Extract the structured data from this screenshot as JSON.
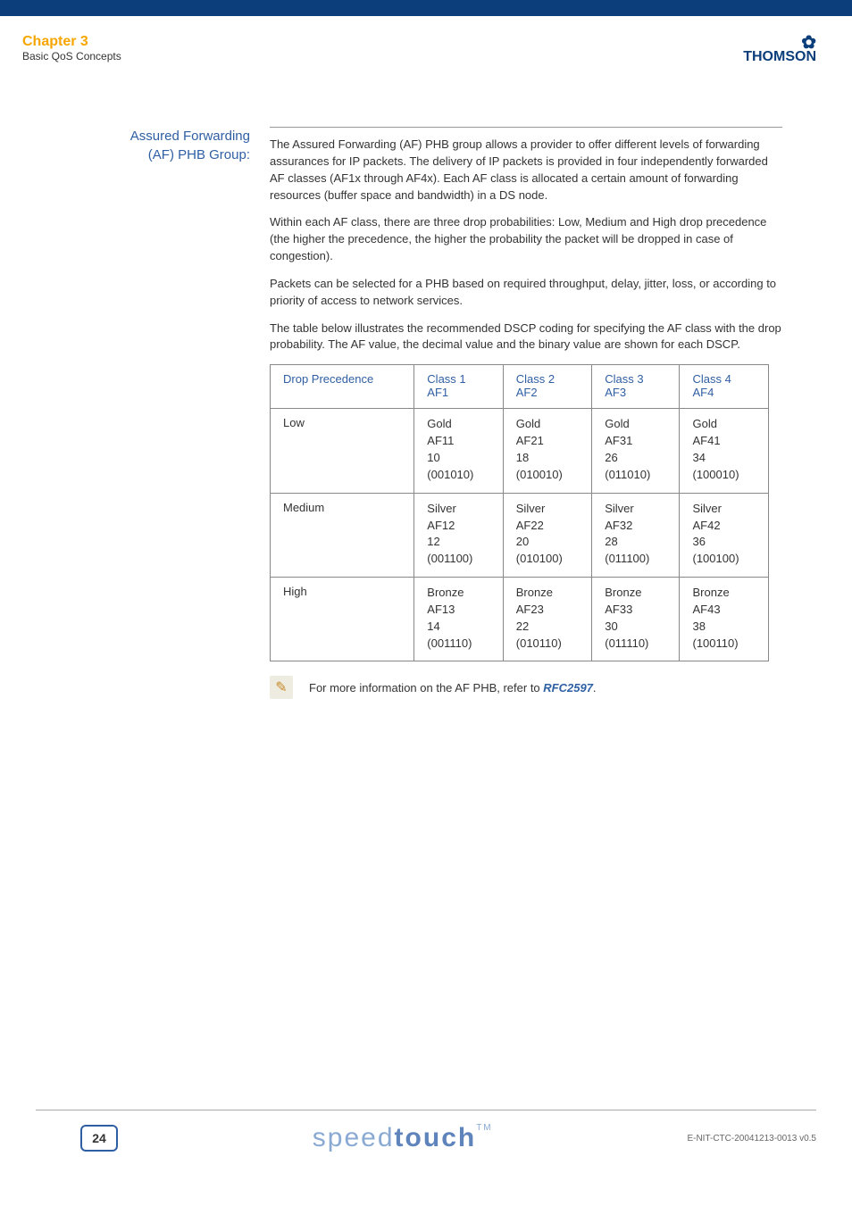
{
  "header": {
    "chapter": "Chapter 3",
    "subtitle": "Basic QoS Concepts",
    "brand": "THOMSON"
  },
  "section": {
    "label_line1": "Assured Forwarding",
    "label_line2": "(AF) PHB Group:",
    "paragraphs": {
      "p1": "The Assured Forwarding (AF) PHB group allows a provider to offer different levels of forwarding assurances for IP packets. The delivery of IP packets is provided in four independently forwarded AF classes (AF1x through AF4x). Each AF class is allocated a certain amount of forwarding resources (buffer space and bandwidth) in a DS node.",
      "p2": "Within each AF class, there are three drop probabilities: Low, Medium and High drop precedence (the higher the precedence, the higher the probability the packet will be dropped in case of congestion).",
      "p3": "Packets can be selected for a PHB based on required throughput, delay, jitter, loss, or according to priority of access to network services.",
      "p4": "The table below illustrates the recommended DSCP coding for specifying the AF class with the drop probability. The AF value, the decimal value and the binary value are shown for each DSCP."
    }
  },
  "table": {
    "headers": {
      "col0": "Drop Precedence",
      "col1_l1": "Class 1",
      "col1_l2": "AF1",
      "col2_l1": "Class 2",
      "col2_l2": "AF2",
      "col3_l1": "Class 3",
      "col3_l2": "AF3",
      "col4_l1": "Class 4",
      "col4_l2": "AF4"
    },
    "rows": {
      "low": {
        "label": "Low",
        "c1": {
          "tier": "Gold",
          "af": "AF11",
          "dec": "10",
          "bin": "(001010)"
        },
        "c2": {
          "tier": "Gold",
          "af": "AF21",
          "dec": "18",
          "bin": "(010010)"
        },
        "c3": {
          "tier": "Gold",
          "af": "AF31",
          "dec": "26",
          "bin": "(011010)"
        },
        "c4": {
          "tier": "Gold",
          "af": "AF41",
          "dec": "34",
          "bin": "(100010)"
        }
      },
      "medium": {
        "label": "Medium",
        "c1": {
          "tier": "Silver",
          "af": "AF12",
          "dec": "12",
          "bin": "(001100)"
        },
        "c2": {
          "tier": "Silver",
          "af": "AF22",
          "dec": "20",
          "bin": "(010100)"
        },
        "c3": {
          "tier": "Silver",
          "af": "AF32",
          "dec": "28",
          "bin": "(011100)"
        },
        "c4": {
          "tier": "Silver",
          "af": "AF42",
          "dec": "36",
          "bin": "(100100)"
        }
      },
      "high": {
        "label": "High",
        "c1": {
          "tier": "Bronze",
          "af": "AF13",
          "dec": "14",
          "bin": "(001110)"
        },
        "c2": {
          "tier": "Bronze",
          "af": "AF23",
          "dec": "22",
          "bin": "(010110)"
        },
        "c3": {
          "tier": "Bronze",
          "af": "AF33",
          "dec": "30",
          "bin": "(011110)"
        },
        "c4": {
          "tier": "Bronze",
          "af": "AF43",
          "dec": "38",
          "bin": "(100110)"
        }
      }
    }
  },
  "note": {
    "text_before": "For more information on the AF PHB, refer to ",
    "link": "RFC2597",
    "text_after": "."
  },
  "footer": {
    "page": "24",
    "brand_light": "speed",
    "brand_bold": "touch",
    "tm": "TM",
    "docid": "E-NIT-CTC-20041213-0013 v0.5"
  }
}
